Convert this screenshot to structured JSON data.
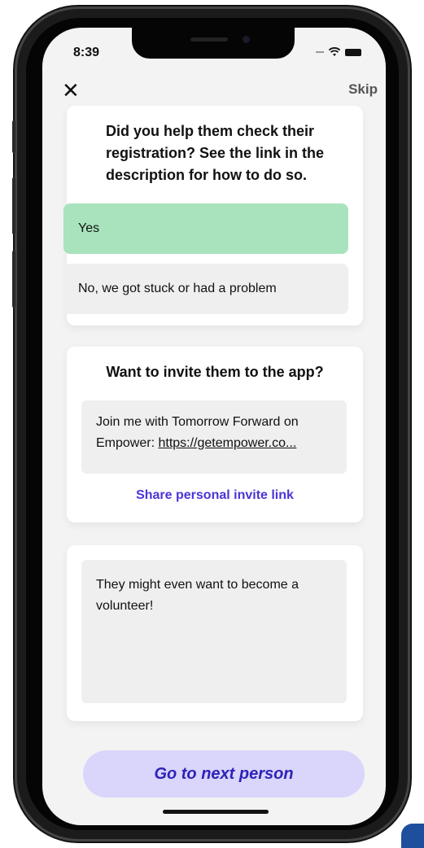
{
  "status_bar": {
    "time": "8:39"
  },
  "nav": {
    "close_glyph": "✕",
    "skip_label": "Skip"
  },
  "registration_card": {
    "question": "Did you help them check their registration? See the link in the description for how to do so.",
    "options": [
      {
        "label": "Yes",
        "selected": true
      },
      {
        "label": "No, we got stuck or had a problem",
        "selected": false
      }
    ]
  },
  "invite_card": {
    "question": "Want to invite them to the app?",
    "message_text": "Join me with Tomorrow Forward on Empower: ",
    "message_link": "https://getempower.co...",
    "share_label": "Share personal invite link"
  },
  "notes_card": {
    "text": "They might even want to become a volunteer!"
  },
  "footer": {
    "next_label": "Go to next person"
  },
  "colors": {
    "selected_option": "#a9e3bd",
    "accent": "#4a35d6",
    "next_button_bg": "#d9d5fb"
  },
  "icons": [
    "close-icon",
    "wifi-icon",
    "battery-icon"
  ]
}
